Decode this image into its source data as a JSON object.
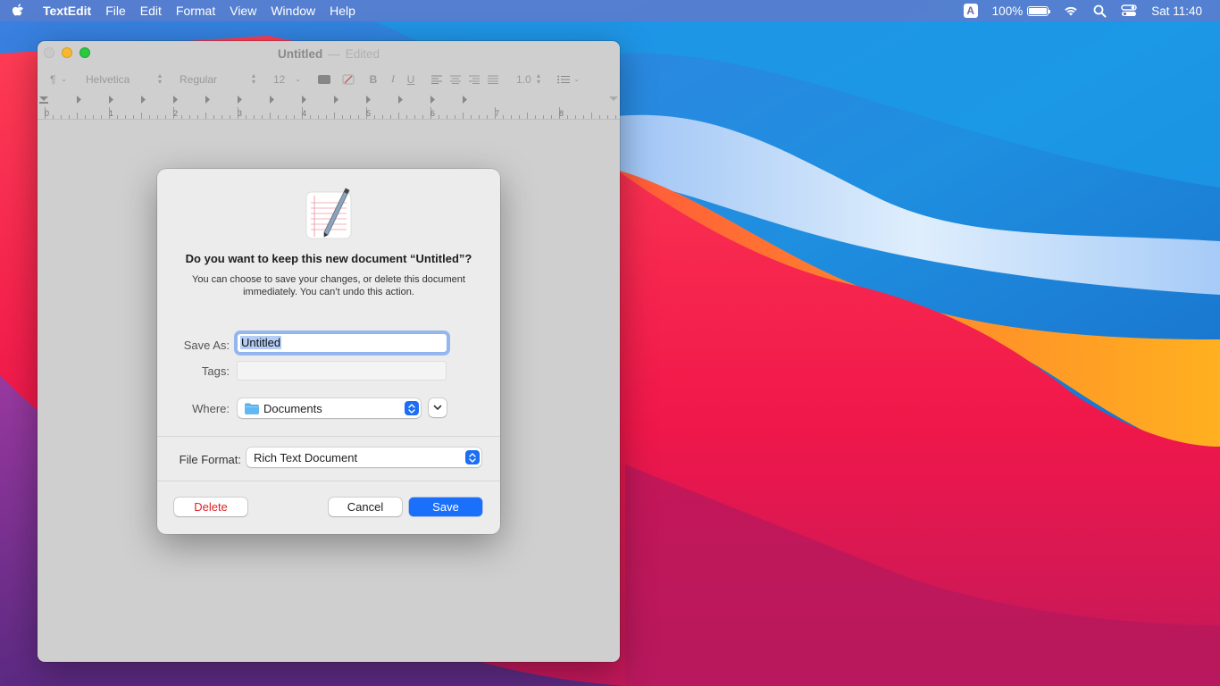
{
  "menubar": {
    "app_name": "TextEdit",
    "menus": [
      "File",
      "Edit",
      "Format",
      "View",
      "Window",
      "Help"
    ],
    "input_source": "A",
    "battery": "100%",
    "clock": "Sat 11:40"
  },
  "window": {
    "title": "Untitled",
    "separator": "—",
    "status": "Edited",
    "toolbar": {
      "paragraph_style": "¶",
      "font_family": "Helvetica",
      "font_style": "Regular",
      "font_size": "12",
      "bold": "B",
      "italic": "I",
      "underline": "U",
      "line_spacing": "1.0"
    },
    "ruler_numbers": [
      "0",
      "1",
      "2",
      "3",
      "4",
      "5",
      "6",
      "7",
      "8"
    ]
  },
  "dialog": {
    "title": "Do you want to keep this new document “Untitled”?",
    "message_line1": "You can choose to save your changes, or delete this document",
    "message_line2": "immediately. You can’t undo this action.",
    "save_as_label": "Save As:",
    "save_as_value": "Untitled",
    "tags_label": "Tags:",
    "where_label": "Where:",
    "where_value": "Documents",
    "file_format_label": "File Format:",
    "file_format_value": "Rich Text Document",
    "delete_label": "Delete",
    "cancel_label": "Cancel",
    "save_label": "Save"
  },
  "colors": {
    "accent": "#1a6ffb",
    "destructive": "#e0242a"
  }
}
